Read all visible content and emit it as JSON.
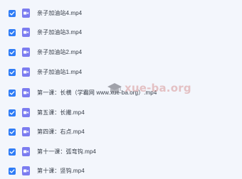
{
  "files": [
    {
      "name": "亲子加油站4.mp4",
      "checked": true
    },
    {
      "name": "亲子加油站3.mp4",
      "checked": true
    },
    {
      "name": "亲子加油站2.mp4",
      "checked": true
    },
    {
      "name": "亲子加油站1.mp4",
      "checked": true
    },
    {
      "name": "第一课：长横（学霸网 www.xue-ba.org）.mp4",
      "checked": true
    },
    {
      "name": "第五课：长撇.mp4",
      "checked": true
    },
    {
      "name": "第四课：右点.mp4",
      "checked": true
    },
    {
      "name": "第十一课：弧弯钩.mp4",
      "checked": true
    },
    {
      "name": "第十课：竖钩.mp4",
      "checked": true
    }
  ],
  "watermark": {
    "text": "xue-ba.org"
  },
  "colors": {
    "checkbox": "#2f7cf6",
    "file_icon": "#7b7cf0",
    "background": "#f3f6fc"
  },
  "icons": {
    "checkbox": "checkmark-icon",
    "file": "video-file-icon",
    "watermark_logo": "graduation-cap-icon"
  }
}
